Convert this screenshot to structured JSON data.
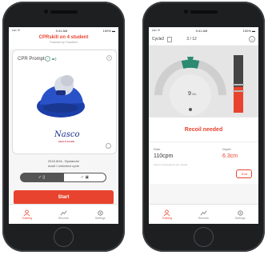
{
  "left_app": {
    "status_bar": {
      "carrier": "•••• ᯤ",
      "time": "9:41 AM",
      "battery": "100% ▬"
    },
    "title": "CPRskill on 4 student",
    "powered_by": "Powered by TrainAlert",
    "card": {
      "label": "CPR Prompt",
      "brand": "Nasco",
      "brand_sub": "HEALTHCARE"
    },
    "mode_line1": "2018 AHA - Bystander",
    "mode_line2": "Adult / Unlimited cycle",
    "toggle_on_icons": "✓  ▯",
    "toggle_off_icons": "✓  ▣",
    "start_label": "Start",
    "tabs": [
      {
        "label": "Training",
        "icon": "person-icon"
      },
      {
        "label": "Records",
        "icon": "records-icon"
      },
      {
        "label": "Settings",
        "icon": "gear-icon"
      }
    ]
  },
  "right_app": {
    "status_bar": {
      "carrier": "•••• ᯤ",
      "time": "9:41 AM",
      "battery": "100% ▬"
    },
    "cycle_label": "Cycle2",
    "cycle_count": "3 / 12",
    "gauge_center": "9",
    "gauge_unit": "/5s",
    "recoil_message": "Recoil needed",
    "rate_label": "Rate",
    "rate_value": "110cpm",
    "rate_note": "Ccpm compressions per minute",
    "depth_label": "Depth",
    "depth_value": "6.3cm",
    "end_label": "End",
    "depth_bar_level": 0.55,
    "accent_color": "#e8432e",
    "tabs": [
      {
        "label": "Training",
        "icon": "person-icon"
      },
      {
        "label": "Records",
        "icon": "records-icon"
      },
      {
        "label": "Settings",
        "icon": "gear-icon"
      }
    ]
  }
}
